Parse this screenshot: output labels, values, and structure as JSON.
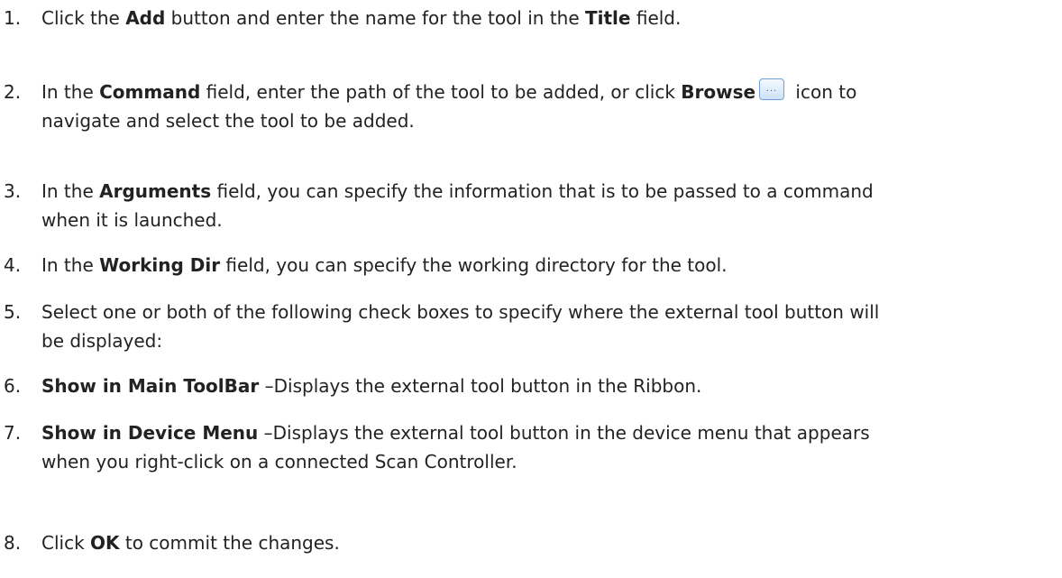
{
  "steps": [
    {
      "number": "1.",
      "before_add": "Click the ",
      "add": "Add",
      "mid": " button and enter the name for the tool in the ",
      "title": "Title",
      "after": " field."
    },
    {
      "number": "2.",
      "before": "In the ",
      "command": "Command",
      "mid": " field, enter the path of the tool to be added, or click ",
      "browse": "Browse",
      "browse_icon_glyph": "...",
      "after": " icon to",
      "line2": "navigate and select the tool to be added."
    },
    {
      "number": "3.",
      "before": "In the ",
      "arguments": "Arguments",
      "after": " field, you can specify the information that is to be passed to a command",
      "line2": "when it is launched."
    },
    {
      "number": "4.",
      "before": "In the ",
      "working_dir": "Working Dir",
      "after": " field, you can specify the working directory for the tool."
    },
    {
      "number": "5.",
      "text": "Select one or both of the following check boxes to specify where the external tool button will",
      "line2": "be displayed:"
    },
    {
      "number": "6.",
      "bold": "Show in Main ToolBar",
      "after": " –Displays the external tool button in the Ribbon."
    },
    {
      "number": "7.",
      "bold": "Show in Device Menu",
      "after": " –Displays the external tool button in the device menu that appears",
      "line2": "when you right-click on a connected Scan Controller."
    },
    {
      "number": "8.",
      "before": "Click ",
      "ok": "OK",
      "after": " to commit the changes."
    }
  ],
  "icons": {
    "browse": "browse-ellipsis-icon"
  }
}
